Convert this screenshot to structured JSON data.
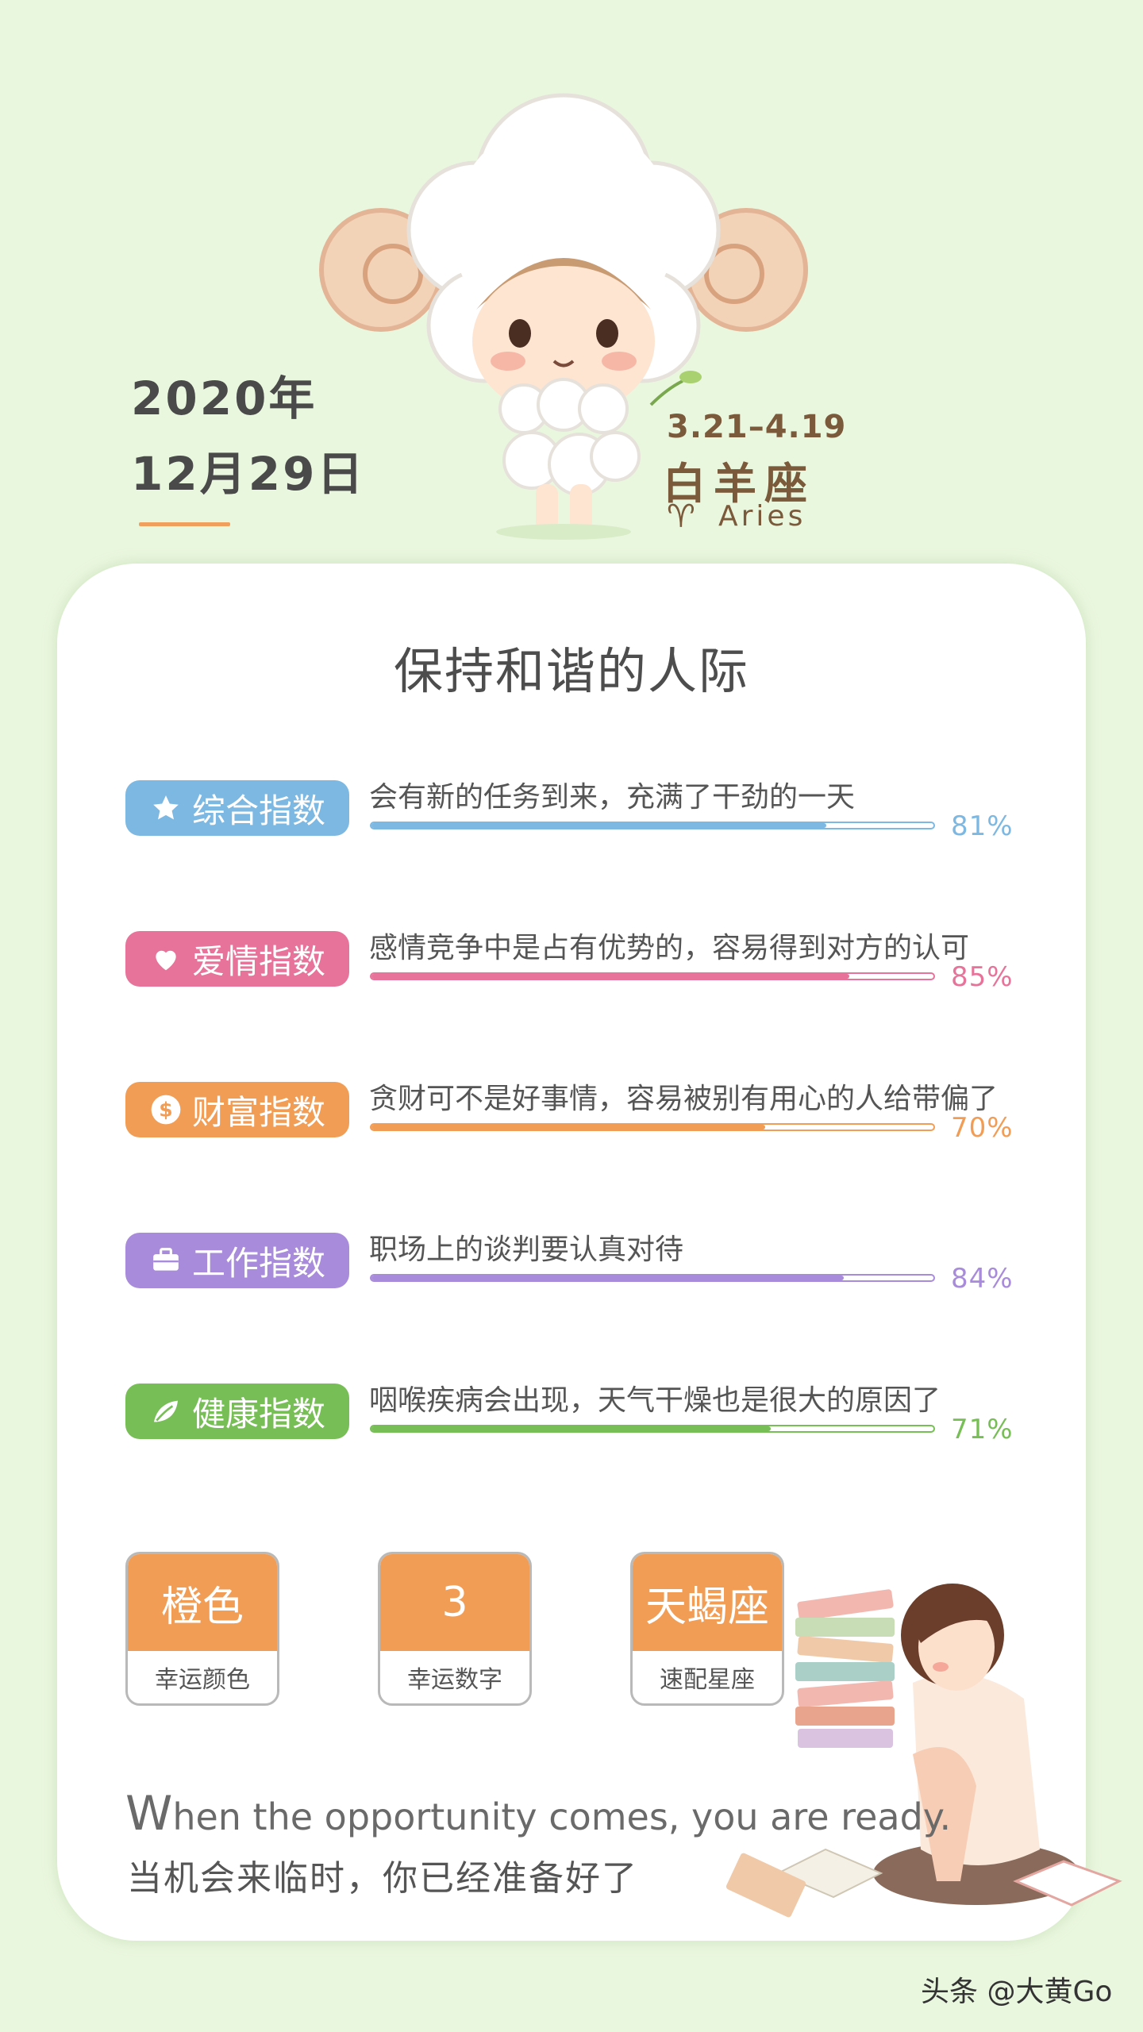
{
  "header": {
    "date_line1": "2020年",
    "date_line2": "12月29日"
  },
  "zodiac": {
    "dates": "3.21–4.19",
    "name": "白羊座",
    "symbol": "♈",
    "english": "Aries"
  },
  "card": {
    "title": "保持和谐的人际",
    "indices": [
      {
        "label": "综合指数",
        "icon": "star-icon",
        "text": "会有新的任务到来，充满了干劲的一天",
        "percent_text": "81%",
        "percent": 81,
        "color": "#7db8e2"
      },
      {
        "label": "爱情指数",
        "icon": "heart-icon",
        "text": "感情竞争中是占有优势的，容易得到对方的认可",
        "percent_text": "85%",
        "percent": 85,
        "color": "#e8739a"
      },
      {
        "label": "财富指数",
        "icon": "dollar-icon",
        "text": "贪财可不是好事情，容易被别有用心的人给带偏了",
        "percent_text": "70%",
        "percent": 70,
        "color": "#f29d55"
      },
      {
        "label": "工作指数",
        "icon": "briefcase-icon",
        "text": "职场上的谈判要认真对待",
        "percent_text": "84%",
        "percent": 84,
        "color": "#a98bdb"
      },
      {
        "label": "健康指数",
        "icon": "leaf-icon",
        "text": "咽喉疾病会出现，天气干燥也是很大的原因了",
        "percent_text": "71%",
        "percent": 71,
        "color": "#78be57"
      }
    ],
    "lucky": [
      {
        "value": "橙色",
        "label": "幸运颜色"
      },
      {
        "value": "3",
        "label": "幸运数字"
      },
      {
        "value": "天蝎座",
        "label": "速配星座"
      }
    ],
    "quote_en_first": "W",
    "quote_en_rest": "hen the opportunity comes, you are ready.",
    "quote_cn": "当机会来临时，你已经准备好了"
  },
  "footer": {
    "watermark": "头条 @大黄Go"
  }
}
